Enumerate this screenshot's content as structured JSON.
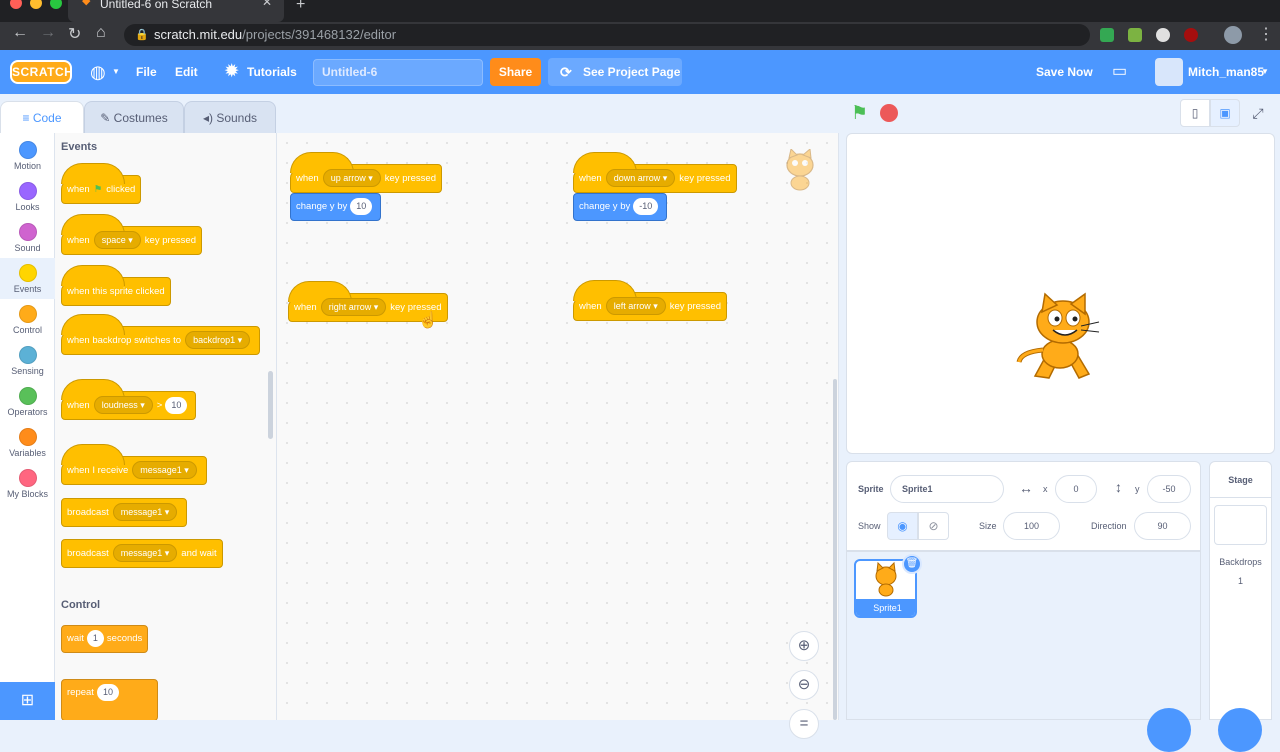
{
  "browser": {
    "tab_title": "Untitled-6 on Scratch",
    "url_domain": "scratch.mit.edu",
    "url_path": "/projects/391468132/editor"
  },
  "menu": {
    "logo": "SCRATCH",
    "file": "File",
    "edit": "Edit",
    "tutorials": "Tutorials",
    "project_title": "Untitled-6",
    "share": "Share",
    "see_project_page": "See Project Page",
    "save_now": "Save Now",
    "username": "Mitch_man85"
  },
  "editor_tabs": {
    "code": "Code",
    "costumes": "Costumes",
    "sounds": "Sounds"
  },
  "categories": [
    {
      "label": "Motion",
      "color": "#4c97ff"
    },
    {
      "label": "Looks",
      "color": "#9966ff"
    },
    {
      "label": "Sound",
      "color": "#cf63cf"
    },
    {
      "label": "Events",
      "color": "#ffd500"
    },
    {
      "label": "Control",
      "color": "#ffab19"
    },
    {
      "label": "Sensing",
      "color": "#5cb1d6"
    },
    {
      "label": "Operators",
      "color": "#59c059"
    },
    {
      "label": "Variables",
      "color": "#ff8c1a"
    },
    {
      "label": "My Blocks",
      "color": "#ff6680"
    }
  ],
  "palette": {
    "events_heading": "Events",
    "when": "when",
    "clicked": "clicked",
    "space": "space",
    "key_pressed": "key pressed",
    "when_sprite_clicked": "when this sprite clicked",
    "when_backdrop": "when backdrop switches to",
    "backdrop1": "backdrop1",
    "loudness": "loudness",
    "gt": ">",
    "loud_val": "10",
    "when_receive": "when I receive",
    "message1": "message1",
    "broadcast": "broadcast",
    "and_wait": "and wait",
    "control_heading": "Control",
    "wait": "wait",
    "wait_val": "1",
    "seconds": "seconds",
    "repeat": "repeat",
    "repeat_val": "10"
  },
  "scripts": {
    "when": "when",
    "key_pressed": "key pressed",
    "change_y_by": "change y by",
    "up_arrow": "up arrow",
    "up_val": "10",
    "down_arrow": "down arrow",
    "down_val": "-10",
    "right_arrow": "right arrow",
    "left_arrow": "left arrow"
  },
  "sprite_info": {
    "sprite_label": "Sprite",
    "sprite_name": "Sprite1",
    "x_label": "x",
    "x_val": "0",
    "y_label": "y",
    "y_val": "-50",
    "show_label": "Show",
    "size_label": "Size",
    "size_val": "100",
    "direction_label": "Direction",
    "direction_val": "90"
  },
  "sprite_list": {
    "sprite1": "Sprite1"
  },
  "stage_panel": {
    "title": "Stage",
    "backdrops_label": "Backdrops",
    "backdrops_count": "1"
  }
}
